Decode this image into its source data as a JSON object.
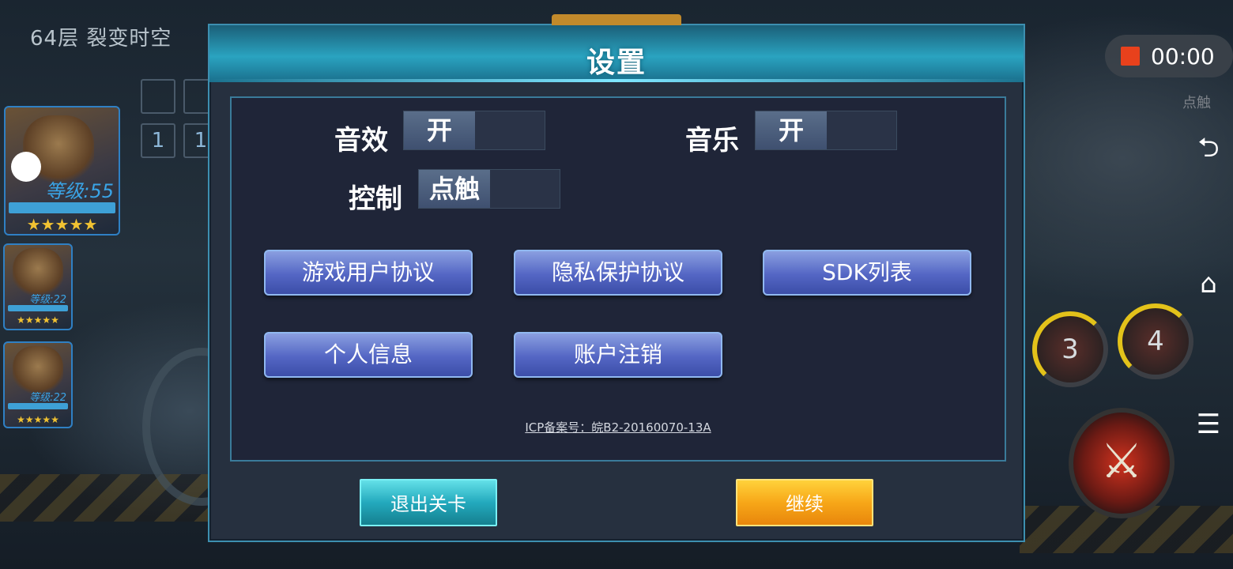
{
  "level": {
    "title": "64层  裂变时空"
  },
  "heroes": [
    {
      "level_label": "等级:55",
      "stars": "★★★★★"
    },
    {
      "level_label": "等级:22",
      "stars": "★★★★★"
    },
    {
      "level_label": "等级:22",
      "stars": "★★★★★"
    }
  ],
  "skills_left": [
    "1",
    "1"
  ],
  "record": {
    "time": "00:00"
  },
  "right_hud": {
    "tap_label": "点触",
    "skill_3": "3",
    "skill_4": "4"
  },
  "dialog": {
    "title": "设置",
    "sound_label": "音效",
    "sound_value": "开",
    "music_label": "音乐",
    "music_value": "开",
    "control_label": "控制",
    "control_value": "点触",
    "buttons": {
      "user_agreement": "游戏用户协议",
      "privacy": "隐私保护协议",
      "sdk_list": "SDK列表",
      "personal_info": "个人信息",
      "account_cancel": "账户注销"
    },
    "icp": "ICP备案号：皖B2-20160070-13A",
    "exit_label": "退出关卡",
    "continue_label": "继续"
  }
}
